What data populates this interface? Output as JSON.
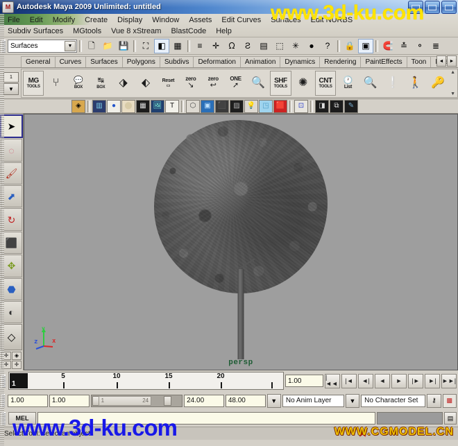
{
  "window": {
    "title": "Autodesk Maya 2009 Unlimited: untitled",
    "app_icon": "maya-icon",
    "minimize": "_",
    "maximize": "□",
    "close": "×"
  },
  "menubar": {
    "row1": [
      "File",
      "Edit",
      "Modify",
      "Create",
      "Display",
      "Window",
      "Assets",
      "Edit Curves",
      "Surfaces",
      "Edit NURBS"
    ],
    "row2": [
      "Subdiv Surfaces",
      "MGtools",
      "Vue 8 xStream",
      "BlastCode",
      "Help"
    ]
  },
  "statusline": {
    "menu_set": "Surfaces",
    "menu_set_arrow": "▼",
    "buttons": [
      {
        "name": "new-scene",
        "glyph": "🗋"
      },
      {
        "name": "open-scene",
        "glyph": "📁"
      },
      {
        "name": "save-scene",
        "glyph": "💾"
      },
      {
        "name": "select-by-hierarchy",
        "glyph": "⛶"
      },
      {
        "name": "select-by-object-type",
        "glyph": "◧"
      },
      {
        "name": "select-by-component-type",
        "glyph": "▦"
      },
      {
        "name": "highlight-selection-mode",
        "glyph": "≡"
      },
      {
        "name": "select-handles",
        "glyph": "✛"
      },
      {
        "name": "nurbs-curves-filter",
        "glyph": "ᘯ"
      },
      {
        "name": "nurbs-surfaces-filter",
        "glyph": "Ƨ"
      },
      {
        "name": "polygons-filter",
        "glyph": "▤"
      },
      {
        "name": "subdiv-surfaces-filter",
        "glyph": "⬚"
      },
      {
        "name": "particles-filter",
        "glyph": "✳"
      },
      {
        "name": "deformers-filter",
        "glyph": "●"
      },
      {
        "name": "misc-filter",
        "glyph": "?"
      },
      {
        "name": "lock-selection",
        "glyph": "🔒"
      },
      {
        "name": "render-view-region",
        "glyph": "▣"
      },
      {
        "name": "snap-to-grids",
        "glyph": "🧲"
      },
      {
        "name": "snap-to-curves",
        "glyph": "≛"
      },
      {
        "name": "snap-to-points",
        "glyph": "⚬"
      },
      {
        "name": "snap-to-view-planes",
        "glyph": "≣"
      }
    ]
  },
  "shelf": {
    "tabs": [
      "General",
      "Curves",
      "Surfaces",
      "Polygons",
      "Subdivs",
      "Deformation",
      "Animation",
      "Dynamics",
      "Rendering",
      "PaintEffects",
      "Toon",
      "Musc"
    ],
    "active_tab": "Toon",
    "tab_scroll_left": "◄",
    "tab_scroll_right": "►",
    "shelf_index": "1",
    "shelf_menu_arrow": "▼",
    "items": [
      {
        "name": "mg-tools",
        "line1": "MG",
        "line2": "TOOLS"
      },
      {
        "name": "mg-rig-tool",
        "glyph": "⑂"
      },
      {
        "name": "box-speech",
        "line1": "💬",
        "line2": "BOX"
      },
      {
        "name": "box-stretch",
        "line1": "↹",
        "line2": "BOX"
      },
      {
        "name": "surface-gear",
        "glyph": "⬗"
      },
      {
        "name": "surface-plus",
        "glyph": "⬖"
      },
      {
        "name": "reset-tool",
        "line1": "Reset",
        "line2": "▭"
      },
      {
        "name": "zero-tool-a",
        "line1": "zero",
        "line2": "↘"
      },
      {
        "name": "zero-tool-b",
        "line1": "zero",
        "line2": "↩"
      },
      {
        "name": "one-tool",
        "line1": "ONE",
        "line2": "➚"
      },
      {
        "name": "magnify-tool",
        "glyph": "🔍"
      },
      {
        "name": "shf-tools",
        "line1": "SHF",
        "line2": "TOOLS"
      },
      {
        "name": "splash-tool",
        "glyph": "✺"
      },
      {
        "name": "cnt-tools",
        "line1": "CNT",
        "line2": "TOOLS"
      },
      {
        "name": "list-tool",
        "line1": "🕐",
        "line2": "List"
      },
      {
        "name": "search-tool",
        "glyph": "🔍"
      },
      {
        "name": "info-tool",
        "glyph": "❕"
      },
      {
        "name": "character-tool",
        "glyph": "🚶"
      },
      {
        "name": "key-tool",
        "glyph": "🔑"
      }
    ],
    "scroll_up": "▲",
    "scroll_down": "▼"
  },
  "iconrow": {
    "items": [
      {
        "name": "layer-editor-icon",
        "glyph": "◈"
      },
      {
        "name": "film-icon",
        "glyph": "▥"
      },
      {
        "name": "sphere-render-icon",
        "glyph": "●"
      },
      {
        "name": "circle-fill-icon",
        "glyph": "⬤"
      },
      {
        "name": "grid-icon",
        "glyph": "▦"
      },
      {
        "name": "image-plane-icon",
        "glyph": "🖼"
      },
      {
        "name": "text-icon",
        "glyph": "T"
      },
      {
        "name": "wireframe-box-icon",
        "glyph": "⬡"
      },
      {
        "name": "smooth-shade-box-icon",
        "glyph": "▣"
      },
      {
        "name": "flat-shade-box-icon",
        "glyph": "⬛"
      },
      {
        "name": "texture-box-icon",
        "glyph": "▨"
      },
      {
        "name": "light-bulb-icon",
        "glyph": "💡"
      },
      {
        "name": "shadow-box-icon",
        "glyph": "◳"
      },
      {
        "name": "red-box-icon",
        "glyph": "🟥"
      },
      {
        "name": "isolate-select-icon",
        "glyph": "⊡"
      },
      {
        "name": "xray-box-icon",
        "glyph": "◨"
      },
      {
        "name": "xray-joints-icon",
        "glyph": "⧉"
      },
      {
        "name": "paint-icon",
        "glyph": "✎"
      }
    ]
  },
  "toolbox": {
    "tools": [
      {
        "name": "select-tool",
        "glyph": "➤",
        "selected": true
      },
      {
        "name": "lasso-tool",
        "glyph": "◌"
      },
      {
        "name": "paint-select-tool",
        "glyph": "🖌"
      },
      {
        "name": "move-tool",
        "glyph": "⬈"
      },
      {
        "name": "rotate-tool",
        "glyph": "↻"
      },
      {
        "name": "scale-tool",
        "glyph": "⬛"
      },
      {
        "name": "universal-manipulator",
        "glyph": "✥"
      },
      {
        "name": "soft-modification-tool",
        "glyph": "⬣"
      },
      {
        "name": "show-manipulator-tool",
        "glyph": "◐"
      }
    ],
    "quick_layout_label": "single-perspective-layout",
    "quick_layout_glyph": "◇",
    "layout_cells": [
      "✛",
      "◈",
      "✛",
      "✛"
    ]
  },
  "viewport": {
    "camera_label": "persp",
    "axis_x": "x",
    "axis_y": "y",
    "axis_z": "z",
    "background_color": "#9e9e9e",
    "model": "tree-model"
  },
  "timeslider": {
    "current_frame": "1",
    "tick_labels": [
      "5",
      "10",
      "15",
      "20"
    ],
    "current_time_field": "1.00",
    "playback_buttons": [
      {
        "name": "go-to-start",
        "glyph": "|◄◄"
      },
      {
        "name": "step-back-key",
        "glyph": "|◄"
      },
      {
        "name": "step-back-frame",
        "glyph": "◄|"
      },
      {
        "name": "play-backwards",
        "glyph": "◄"
      },
      {
        "name": "play-forwards",
        "glyph": "►"
      },
      {
        "name": "step-forward-frame",
        "glyph": "|►"
      },
      {
        "name": "step-forward-key",
        "glyph": "►|"
      },
      {
        "name": "go-to-end",
        "glyph": "►►|"
      }
    ]
  },
  "rangeslider": {
    "anim_start": "1.00",
    "range_start": "1.00",
    "range_bar_min": "1",
    "range_bar_max": "24",
    "range_end": "24.00",
    "anim_end": "48.00",
    "dropdown_arrow": "▼",
    "anim_layer": "No Anim Layer",
    "anim_layer_arrow": "▼",
    "character_set": "No Character Set",
    "key_button": "key-icon",
    "key_glyph": "⚷",
    "prefs_button": "animation-preferences-icon",
    "prefs_glyph": "▩"
  },
  "command_line": {
    "mel_label": "MEL",
    "command_value": "",
    "command_placeholder": "",
    "output_value": "",
    "script_editor_glyph": "▤"
  },
  "help_line": {
    "text": "Select Tool: select an object"
  },
  "watermarks": {
    "top": "www.3d-ku.com",
    "bottom": "www.3d-ku.com",
    "corner": "WWW.CGMODEL.CN",
    "star": "★"
  },
  "colors": {
    "chrome": "#d4d0c8",
    "title_blue": "#2b5fc0",
    "viewport_gray": "#9e9e9e",
    "watermark_yellow": "#ffe400",
    "watermark_blue": "#1818e8",
    "persp_green": "#1e5c34",
    "field_cream": "#fbfae8"
  }
}
